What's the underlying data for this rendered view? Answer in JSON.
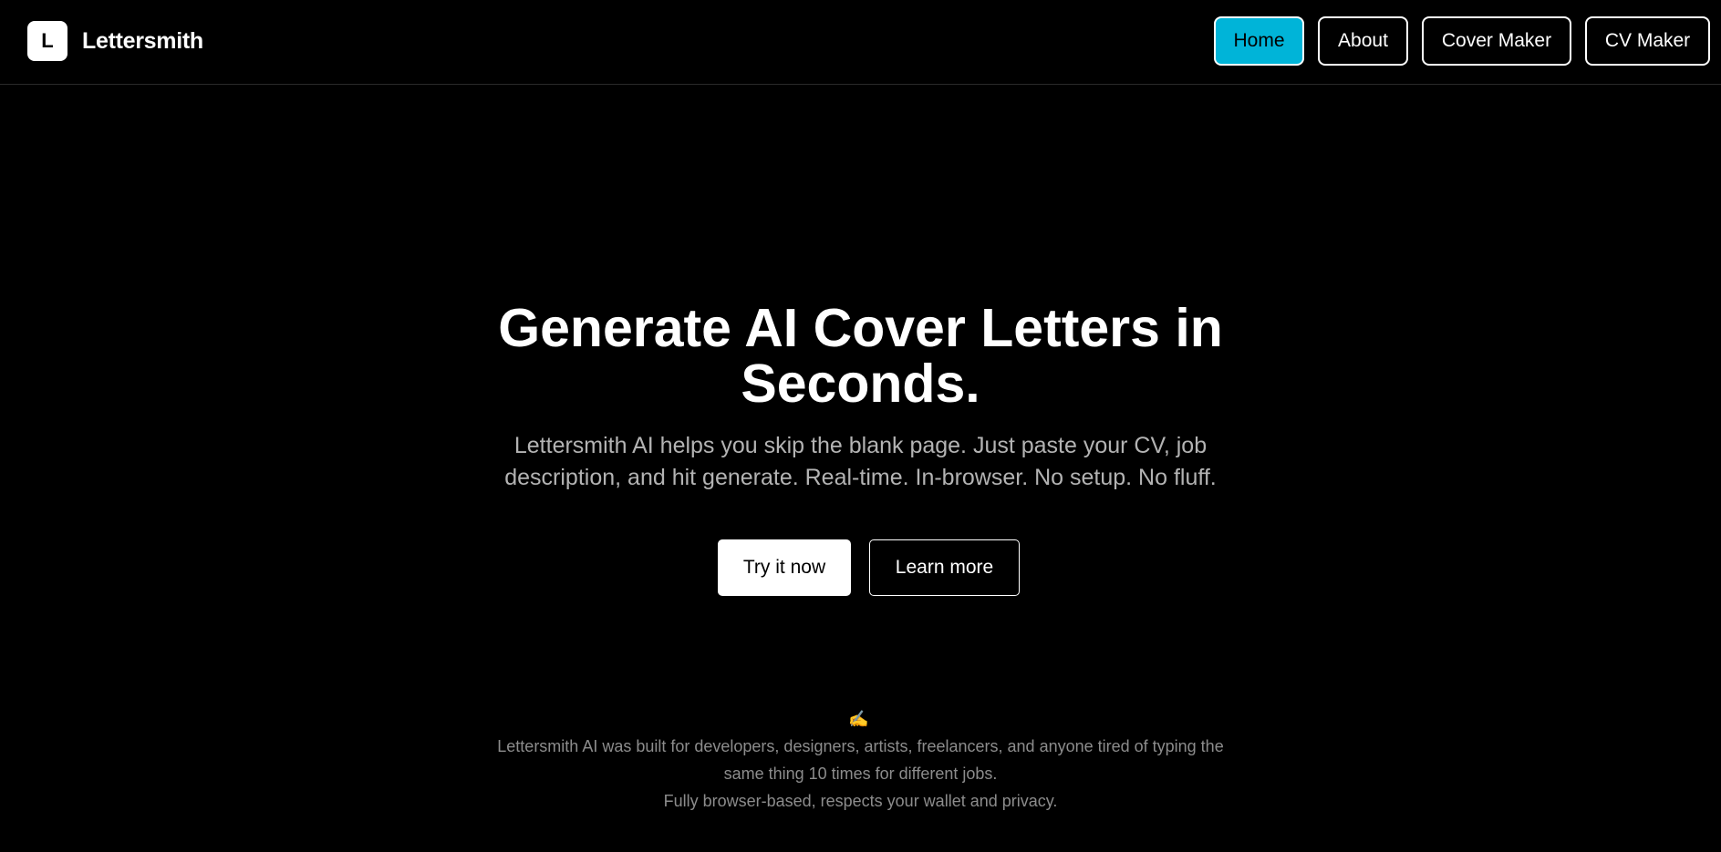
{
  "brand": {
    "logo_letter": "L",
    "name": "Lettersmith"
  },
  "nav": {
    "items": [
      {
        "label": "Home",
        "active": true
      },
      {
        "label": "About",
        "active": false
      },
      {
        "label": "Cover Maker",
        "active": false
      },
      {
        "label": "CV Maker",
        "active": false
      }
    ]
  },
  "hero": {
    "title_line1": "Generate AI Cover Letters in",
    "title_line2": "Seconds.",
    "subtitle_line1": "Lettersmith AI helps you skip the blank page. Just paste your CV, job",
    "subtitle_line2": "description, and hit generate. Real-time. In-browser. No setup. No fluff."
  },
  "cta": {
    "primary_label": "Try it now",
    "secondary_label": "Learn more"
  },
  "footer": {
    "icon": "✍",
    "line1": "Lettersmith AI was built for developers, designers, artists, freelancers, and anyone tired of typing the",
    "line2": "same thing 10 times for different jobs.",
    "line3": "Fully browser-based, respects your wallet and privacy."
  },
  "colors": {
    "background": "#000000",
    "accent": "#00b4d8",
    "text": "#ffffff",
    "muted": "#b3b3b3"
  }
}
